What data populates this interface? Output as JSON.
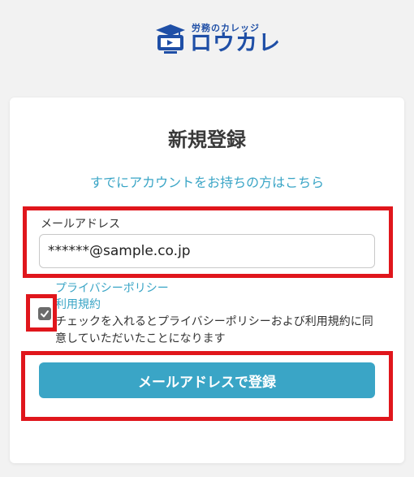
{
  "logo": {
    "small_text": "労務のカレッジ",
    "big_text": "ロウカレ",
    "brand_color": "#1f4fa6",
    "icon": "graduation-cap-monitor-icon"
  },
  "form": {
    "title": "新規登録",
    "login_link": "すでにアカウントをお持ちの方はこちら",
    "email_label": "メールアドレス",
    "email_value": "******@sample.co.jp",
    "privacy_link": "プライバシーポリシー",
    "terms_link": "利用規約",
    "consent_checked": true,
    "consent_text": "チェックを入れるとプライバシーポリシーおよび利用規約に同意していただいたことになります",
    "submit_label": "メールアドレスで登録"
  },
  "colors": {
    "accent": "#3aa5c6",
    "highlight": "#e0161c",
    "background": "#f2f2f2"
  }
}
